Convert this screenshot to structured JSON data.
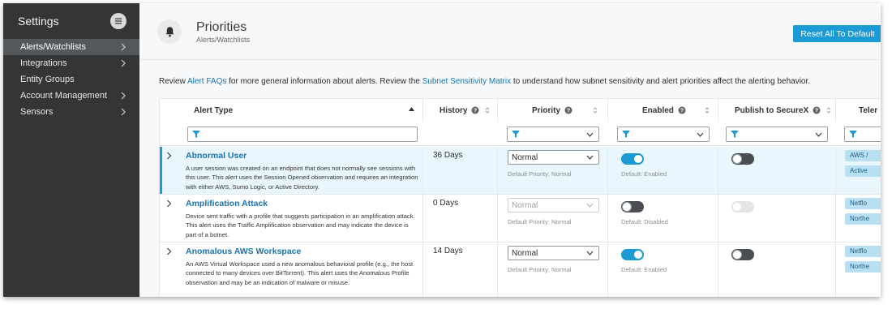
{
  "sidebar": {
    "title": "Settings",
    "items": [
      {
        "label": "Alerts/Watchlists",
        "active": true,
        "has_submenu": true
      },
      {
        "label": "Integrations",
        "active": false,
        "has_submenu": true
      },
      {
        "label": "Entity Groups",
        "active": false,
        "has_submenu": false
      },
      {
        "label": "Account Management",
        "active": false,
        "has_submenu": true
      },
      {
        "label": "Sensors",
        "active": false,
        "has_submenu": true
      }
    ]
  },
  "header": {
    "title": "Priorities",
    "breadcrumb": "Alerts/Watchlists",
    "reset_button": "Reset All To Default"
  },
  "intro": {
    "t1": "Review ",
    "link1": "Alert FAQs",
    "t2": " for more general information about alerts. Review the ",
    "link2": "Subnet Sensitivity Matrix",
    "t3": " to understand how subnet sensitivity and alert priorities affect the alerting behavior."
  },
  "table": {
    "columns": {
      "alert_type": "Alert Type",
      "history": "History",
      "priority": "Priority",
      "enabled": "Enabled",
      "publish": "Publish to SecureX",
      "telemetry": "Teler"
    },
    "rows": [
      {
        "name": "Abnormal User",
        "description": "A user session was created on an endpoint that does not normally see sessions with this user. This alert uses the Session Opened observation and requires an integration with either AWS, Sumo Logic, or Active Directory.",
        "history": "36 Days",
        "priority": "Normal",
        "priority_hint": "Default Priority: Normal",
        "enabled": true,
        "enabled_hint": "Default: Enabled",
        "publish": false,
        "tags": [
          "AWS /",
          "Active"
        ]
      },
      {
        "name": "Amplification Attack",
        "description": "Device sent traffic with a profile that suggests participation in an amplification attack. This alert uses the Traffic Amplification observation and may indicate the device is part of a botnet.",
        "history": "0 Days",
        "priority": "Normal",
        "priority_hint": "Default Priority: Normal",
        "enabled": false,
        "enabled_hint": "Default: Disabled",
        "publish": false,
        "tags": [
          "Netflo",
          "Northe"
        ]
      },
      {
        "name": "Anomalous AWS Workspace",
        "description": "An AWS Virtual Workspace used a new anomalous behavioral profile (e.g., the host connected to many devices over BitTorrent). This alert uses the Anomalous Profile observation and may be an indication of malware or misuse.",
        "history": "14 Days",
        "priority": "Normal",
        "priority_hint": "Default Priority: Normal",
        "enabled": true,
        "enabled_hint": "Default: Enabled",
        "publish": false,
        "tags": [
          "Netflo",
          "Northe"
        ]
      }
    ]
  },
  "colors": {
    "sidebar_bg": "#333537",
    "accent": "#1b9ad6",
    "link": "#1877b5",
    "selected_row": "#eaf6fd",
    "tag_bg": "#b9dff3"
  },
  "icons": {
    "menu": "hamburger-icon",
    "bell": "bell-icon",
    "filter": "filter-funnel-icon",
    "help": "question-circle-icon",
    "sort": "sort-arrows-icon"
  }
}
